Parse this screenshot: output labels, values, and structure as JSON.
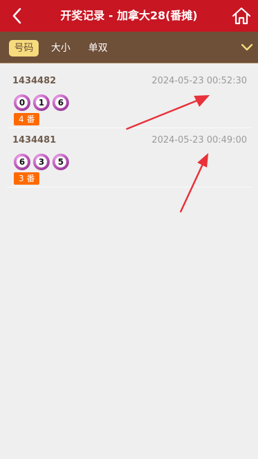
{
  "header": {
    "title": "开奖记录 - 加拿大28(番摊)"
  },
  "tabs": [
    {
      "label": "号码",
      "active": true
    },
    {
      "label": "大小",
      "active": false
    },
    {
      "label": "单双",
      "active": false
    }
  ],
  "records": [
    {
      "issue": "1434482",
      "time": "2024-05-23 00:52:30",
      "numbers": [
        "0",
        "1",
        "6"
      ],
      "fan": "4 番"
    },
    {
      "issue": "1434481",
      "time": "2024-05-23 00:49:00",
      "numbers": [
        "6",
        "3",
        "5"
      ],
      "fan": "3 番"
    }
  ],
  "icons": {
    "back": "chevron-left-icon",
    "home": "home-icon",
    "dropdown": "chevron-down-icon"
  },
  "colors": {
    "header_bg": "#c81623",
    "tabbar_bg": "#6e4f38",
    "active_tab_bg": "#f6dc7d",
    "badge_bg": "#ff6a00",
    "annotation_arrow": "#e8313a"
  }
}
